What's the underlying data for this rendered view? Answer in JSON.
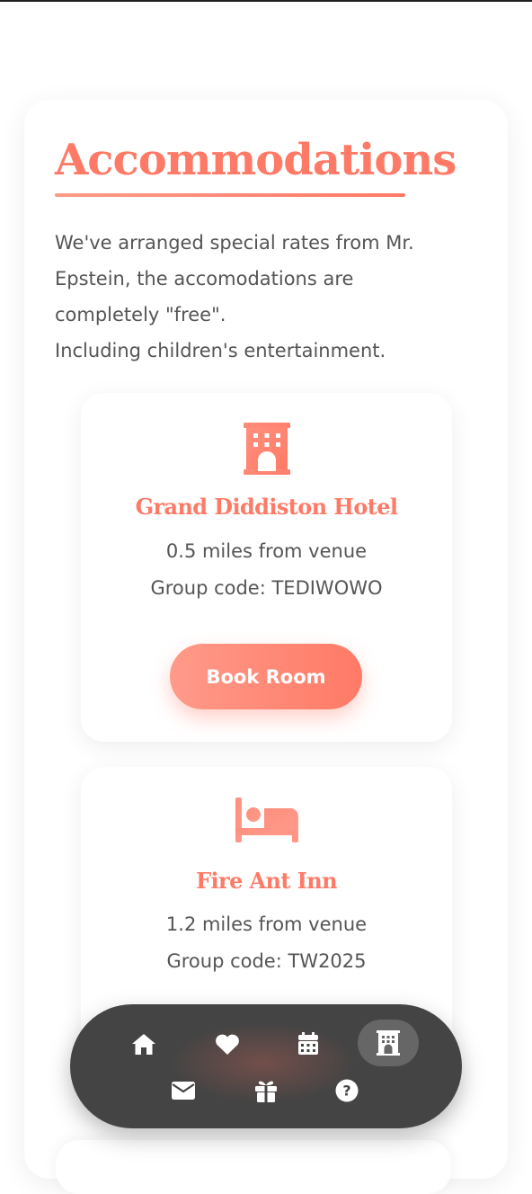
{
  "section": {
    "title": "Accommodations",
    "intro_lines": [
      "We've arranged special rates from Mr.",
      "Epstein, the accomodations are",
      "completely \"free\".",
      "Including children's entertainment."
    ]
  },
  "hotels": [
    {
      "icon": "hotel-building-icon",
      "name": "Grand Diddiston Hotel",
      "distance": "0.5 miles from venue",
      "group_code": "Group code: TEDIWOWO",
      "button_label": "Book Room"
    },
    {
      "icon": "bed-icon",
      "name": "Fire Ant Inn",
      "distance": "1.2 miles from venue",
      "group_code": "Group code: TW2025"
    }
  ],
  "nav": {
    "items": [
      "home-icon",
      "heart-icon",
      "calendar-icon",
      "hotel-icon",
      "mail-icon",
      "gift-icon",
      "help-icon"
    ],
    "active": "hotel-icon"
  },
  "colors": {
    "accent": "#ff7a66",
    "accent_light": "#ff9a8a",
    "text": "#555555",
    "nav_bg": "#444444"
  }
}
